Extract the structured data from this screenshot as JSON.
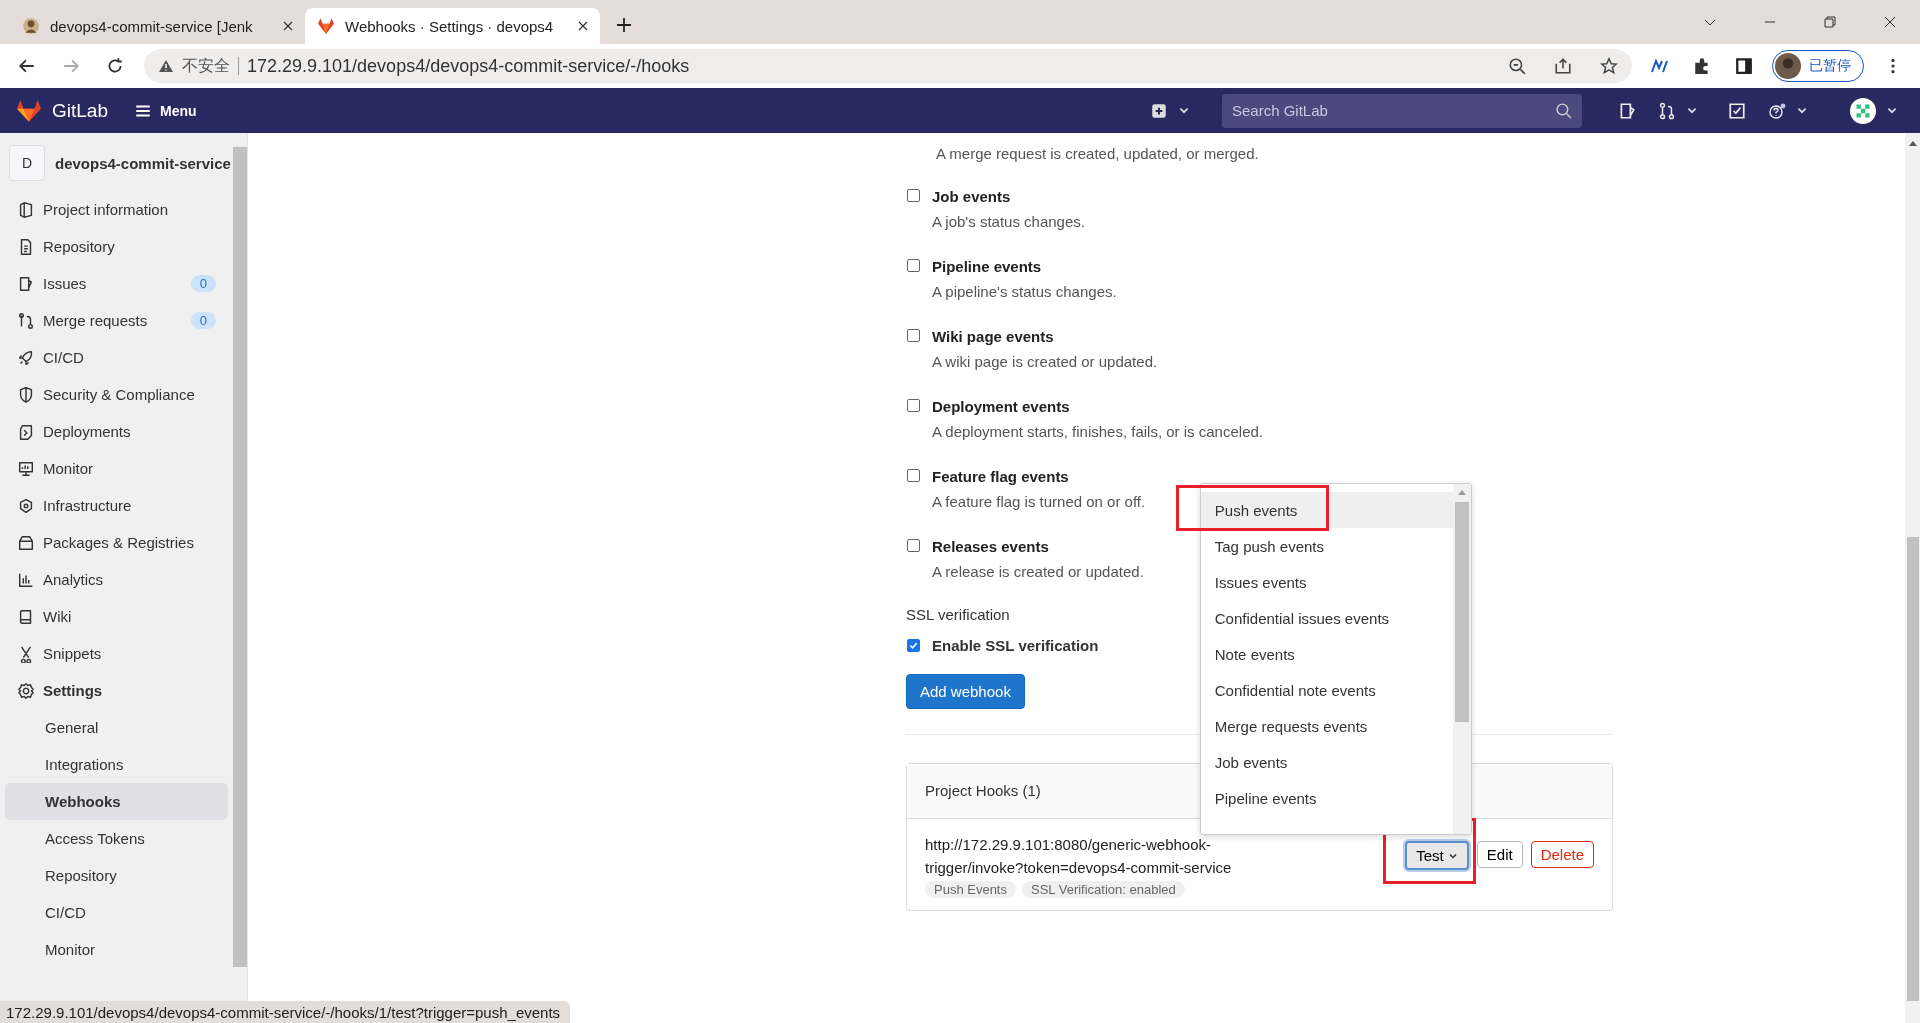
{
  "browser": {
    "tabs": [
      {
        "title": "devops4-commit-service [Jenk",
        "selected": false
      },
      {
        "title": "Webhooks · Settings · devops4",
        "selected": true
      }
    ],
    "security_label": "不安全",
    "url": "172.29.9.101/devops4/devops4-commit-service/-/hooks",
    "profile_label": "已暂停"
  },
  "header": {
    "brand": "GitLab",
    "menu": "Menu",
    "search_placeholder": "Search GitLab"
  },
  "sidebar": {
    "project_initial": "D",
    "project_name": "devops4-commit-service",
    "items": [
      {
        "label": "Project information",
        "expanded": false
      },
      {
        "label": "Repository",
        "expanded": false
      },
      {
        "label": "Issues",
        "badge": "0",
        "expanded": false
      },
      {
        "label": "Merge requests",
        "badge": "0",
        "expanded": false
      },
      {
        "label": "CI/CD",
        "expanded": false
      },
      {
        "label": "Security & Compliance",
        "expanded": false
      },
      {
        "label": "Deployments",
        "expanded": false
      },
      {
        "label": "Monitor",
        "expanded": false
      },
      {
        "label": "Infrastructure",
        "expanded": false
      },
      {
        "label": "Packages & Registries",
        "expanded": false
      },
      {
        "label": "Analytics",
        "expanded": false
      },
      {
        "label": "Wiki",
        "expanded": false
      },
      {
        "label": "Snippets",
        "expanded": false
      },
      {
        "label": "Settings",
        "expanded": true,
        "children": [
          {
            "label": "General",
            "selected": false
          },
          {
            "label": "Integrations",
            "selected": false
          },
          {
            "label": "Webhooks",
            "selected": true
          },
          {
            "label": "Access Tokens",
            "selected": false
          },
          {
            "label": "Repository",
            "selected": false
          },
          {
            "label": "CI/CD",
            "selected": false
          },
          {
            "label": "Monitor",
            "selected": false
          }
        ]
      }
    ]
  },
  "top_description": "A merge request is created, updated, or merged.",
  "events": [
    {
      "label": "Job events",
      "description": "A job's status changes.",
      "checked": false
    },
    {
      "label": "Pipeline events",
      "description": "A pipeline's status changes.",
      "checked": false
    },
    {
      "label": "Wiki page events",
      "description": "A wiki page is created or updated.",
      "checked": false
    },
    {
      "label": "Deployment events",
      "description": "A deployment starts, finishes, fails, or is canceled.",
      "checked": false
    },
    {
      "label": "Feature flag events",
      "description": "A feature flag is turned on or off.",
      "checked": false
    },
    {
      "label": "Releases events",
      "description": "A release is created or updated.",
      "checked": false
    }
  ],
  "ssl": {
    "title": "SSL verification",
    "label": "Enable SSL verification",
    "checked": true
  },
  "add_button": "Add webhook",
  "hooks": {
    "title": "Project Hooks (1)",
    "url": "http://172.29.9.101:8080/generic-webhook-trigger/invoke?token=devops4-commit-service",
    "tags": [
      "Push Events",
      "SSL Verification: enabled"
    ],
    "test_button": "Test",
    "edit_button": "Edit",
    "delete_button": "Delete",
    "dropdown": {
      "expanded": true,
      "items": [
        {
          "label": "Push events",
          "selected": true
        },
        {
          "label": "Tag push events",
          "selected": false
        },
        {
          "label": "Issues events",
          "selected": false
        },
        {
          "label": "Confidential issues events",
          "selected": false
        },
        {
          "label": "Note events",
          "selected": false
        },
        {
          "label": "Confidential note events",
          "selected": false
        },
        {
          "label": "Merge requests events",
          "selected": false
        },
        {
          "label": "Job events",
          "selected": false
        },
        {
          "label": "Pipeline events",
          "selected": false
        }
      ]
    }
  },
  "status_url": "172.29.9.101/devops4/devops4-commit-service/-/hooks/1/test?trigger=push_events"
}
